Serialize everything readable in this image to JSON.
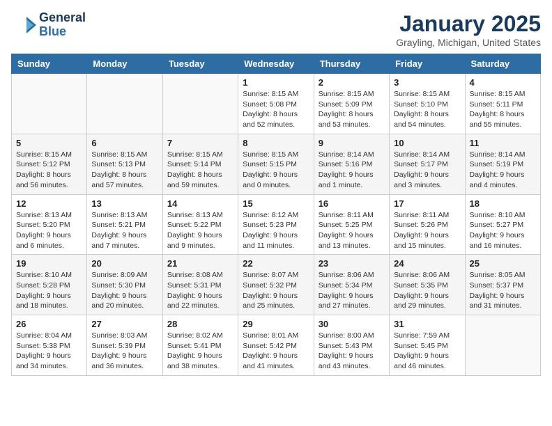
{
  "header": {
    "logo_line1": "General",
    "logo_line2": "Blue",
    "month": "January 2025",
    "location": "Grayling, Michigan, United States"
  },
  "days_of_week": [
    "Sunday",
    "Monday",
    "Tuesday",
    "Wednesday",
    "Thursday",
    "Friday",
    "Saturday"
  ],
  "weeks": [
    [
      {
        "num": "",
        "detail": ""
      },
      {
        "num": "",
        "detail": ""
      },
      {
        "num": "",
        "detail": ""
      },
      {
        "num": "1",
        "detail": "Sunrise: 8:15 AM\nSunset: 5:08 PM\nDaylight: 8 hours and 52 minutes."
      },
      {
        "num": "2",
        "detail": "Sunrise: 8:15 AM\nSunset: 5:09 PM\nDaylight: 8 hours and 53 minutes."
      },
      {
        "num": "3",
        "detail": "Sunrise: 8:15 AM\nSunset: 5:10 PM\nDaylight: 8 hours and 54 minutes."
      },
      {
        "num": "4",
        "detail": "Sunrise: 8:15 AM\nSunset: 5:11 PM\nDaylight: 8 hours and 55 minutes."
      }
    ],
    [
      {
        "num": "5",
        "detail": "Sunrise: 8:15 AM\nSunset: 5:12 PM\nDaylight: 8 hours and 56 minutes."
      },
      {
        "num": "6",
        "detail": "Sunrise: 8:15 AM\nSunset: 5:13 PM\nDaylight: 8 hours and 57 minutes."
      },
      {
        "num": "7",
        "detail": "Sunrise: 8:15 AM\nSunset: 5:14 PM\nDaylight: 8 hours and 59 minutes."
      },
      {
        "num": "8",
        "detail": "Sunrise: 8:15 AM\nSunset: 5:15 PM\nDaylight: 9 hours and 0 minutes."
      },
      {
        "num": "9",
        "detail": "Sunrise: 8:14 AM\nSunset: 5:16 PM\nDaylight: 9 hours and 1 minute."
      },
      {
        "num": "10",
        "detail": "Sunrise: 8:14 AM\nSunset: 5:17 PM\nDaylight: 9 hours and 3 minutes."
      },
      {
        "num": "11",
        "detail": "Sunrise: 8:14 AM\nSunset: 5:19 PM\nDaylight: 9 hours and 4 minutes."
      }
    ],
    [
      {
        "num": "12",
        "detail": "Sunrise: 8:13 AM\nSunset: 5:20 PM\nDaylight: 9 hours and 6 minutes."
      },
      {
        "num": "13",
        "detail": "Sunrise: 8:13 AM\nSunset: 5:21 PM\nDaylight: 9 hours and 7 minutes."
      },
      {
        "num": "14",
        "detail": "Sunrise: 8:13 AM\nSunset: 5:22 PM\nDaylight: 9 hours and 9 minutes."
      },
      {
        "num": "15",
        "detail": "Sunrise: 8:12 AM\nSunset: 5:23 PM\nDaylight: 9 hours and 11 minutes."
      },
      {
        "num": "16",
        "detail": "Sunrise: 8:11 AM\nSunset: 5:25 PM\nDaylight: 9 hours and 13 minutes."
      },
      {
        "num": "17",
        "detail": "Sunrise: 8:11 AM\nSunset: 5:26 PM\nDaylight: 9 hours and 15 minutes."
      },
      {
        "num": "18",
        "detail": "Sunrise: 8:10 AM\nSunset: 5:27 PM\nDaylight: 9 hours and 16 minutes."
      }
    ],
    [
      {
        "num": "19",
        "detail": "Sunrise: 8:10 AM\nSunset: 5:28 PM\nDaylight: 9 hours and 18 minutes."
      },
      {
        "num": "20",
        "detail": "Sunrise: 8:09 AM\nSunset: 5:30 PM\nDaylight: 9 hours and 20 minutes."
      },
      {
        "num": "21",
        "detail": "Sunrise: 8:08 AM\nSunset: 5:31 PM\nDaylight: 9 hours and 22 minutes."
      },
      {
        "num": "22",
        "detail": "Sunrise: 8:07 AM\nSunset: 5:32 PM\nDaylight: 9 hours and 25 minutes."
      },
      {
        "num": "23",
        "detail": "Sunrise: 8:06 AM\nSunset: 5:34 PM\nDaylight: 9 hours and 27 minutes."
      },
      {
        "num": "24",
        "detail": "Sunrise: 8:06 AM\nSunset: 5:35 PM\nDaylight: 9 hours and 29 minutes."
      },
      {
        "num": "25",
        "detail": "Sunrise: 8:05 AM\nSunset: 5:37 PM\nDaylight: 9 hours and 31 minutes."
      }
    ],
    [
      {
        "num": "26",
        "detail": "Sunrise: 8:04 AM\nSunset: 5:38 PM\nDaylight: 9 hours and 34 minutes."
      },
      {
        "num": "27",
        "detail": "Sunrise: 8:03 AM\nSunset: 5:39 PM\nDaylight: 9 hours and 36 minutes."
      },
      {
        "num": "28",
        "detail": "Sunrise: 8:02 AM\nSunset: 5:41 PM\nDaylight: 9 hours and 38 minutes."
      },
      {
        "num": "29",
        "detail": "Sunrise: 8:01 AM\nSunset: 5:42 PM\nDaylight: 9 hours and 41 minutes."
      },
      {
        "num": "30",
        "detail": "Sunrise: 8:00 AM\nSunset: 5:43 PM\nDaylight: 9 hours and 43 minutes."
      },
      {
        "num": "31",
        "detail": "Sunrise: 7:59 AM\nSunset: 5:45 PM\nDaylight: 9 hours and 46 minutes."
      },
      {
        "num": "",
        "detail": ""
      }
    ]
  ]
}
